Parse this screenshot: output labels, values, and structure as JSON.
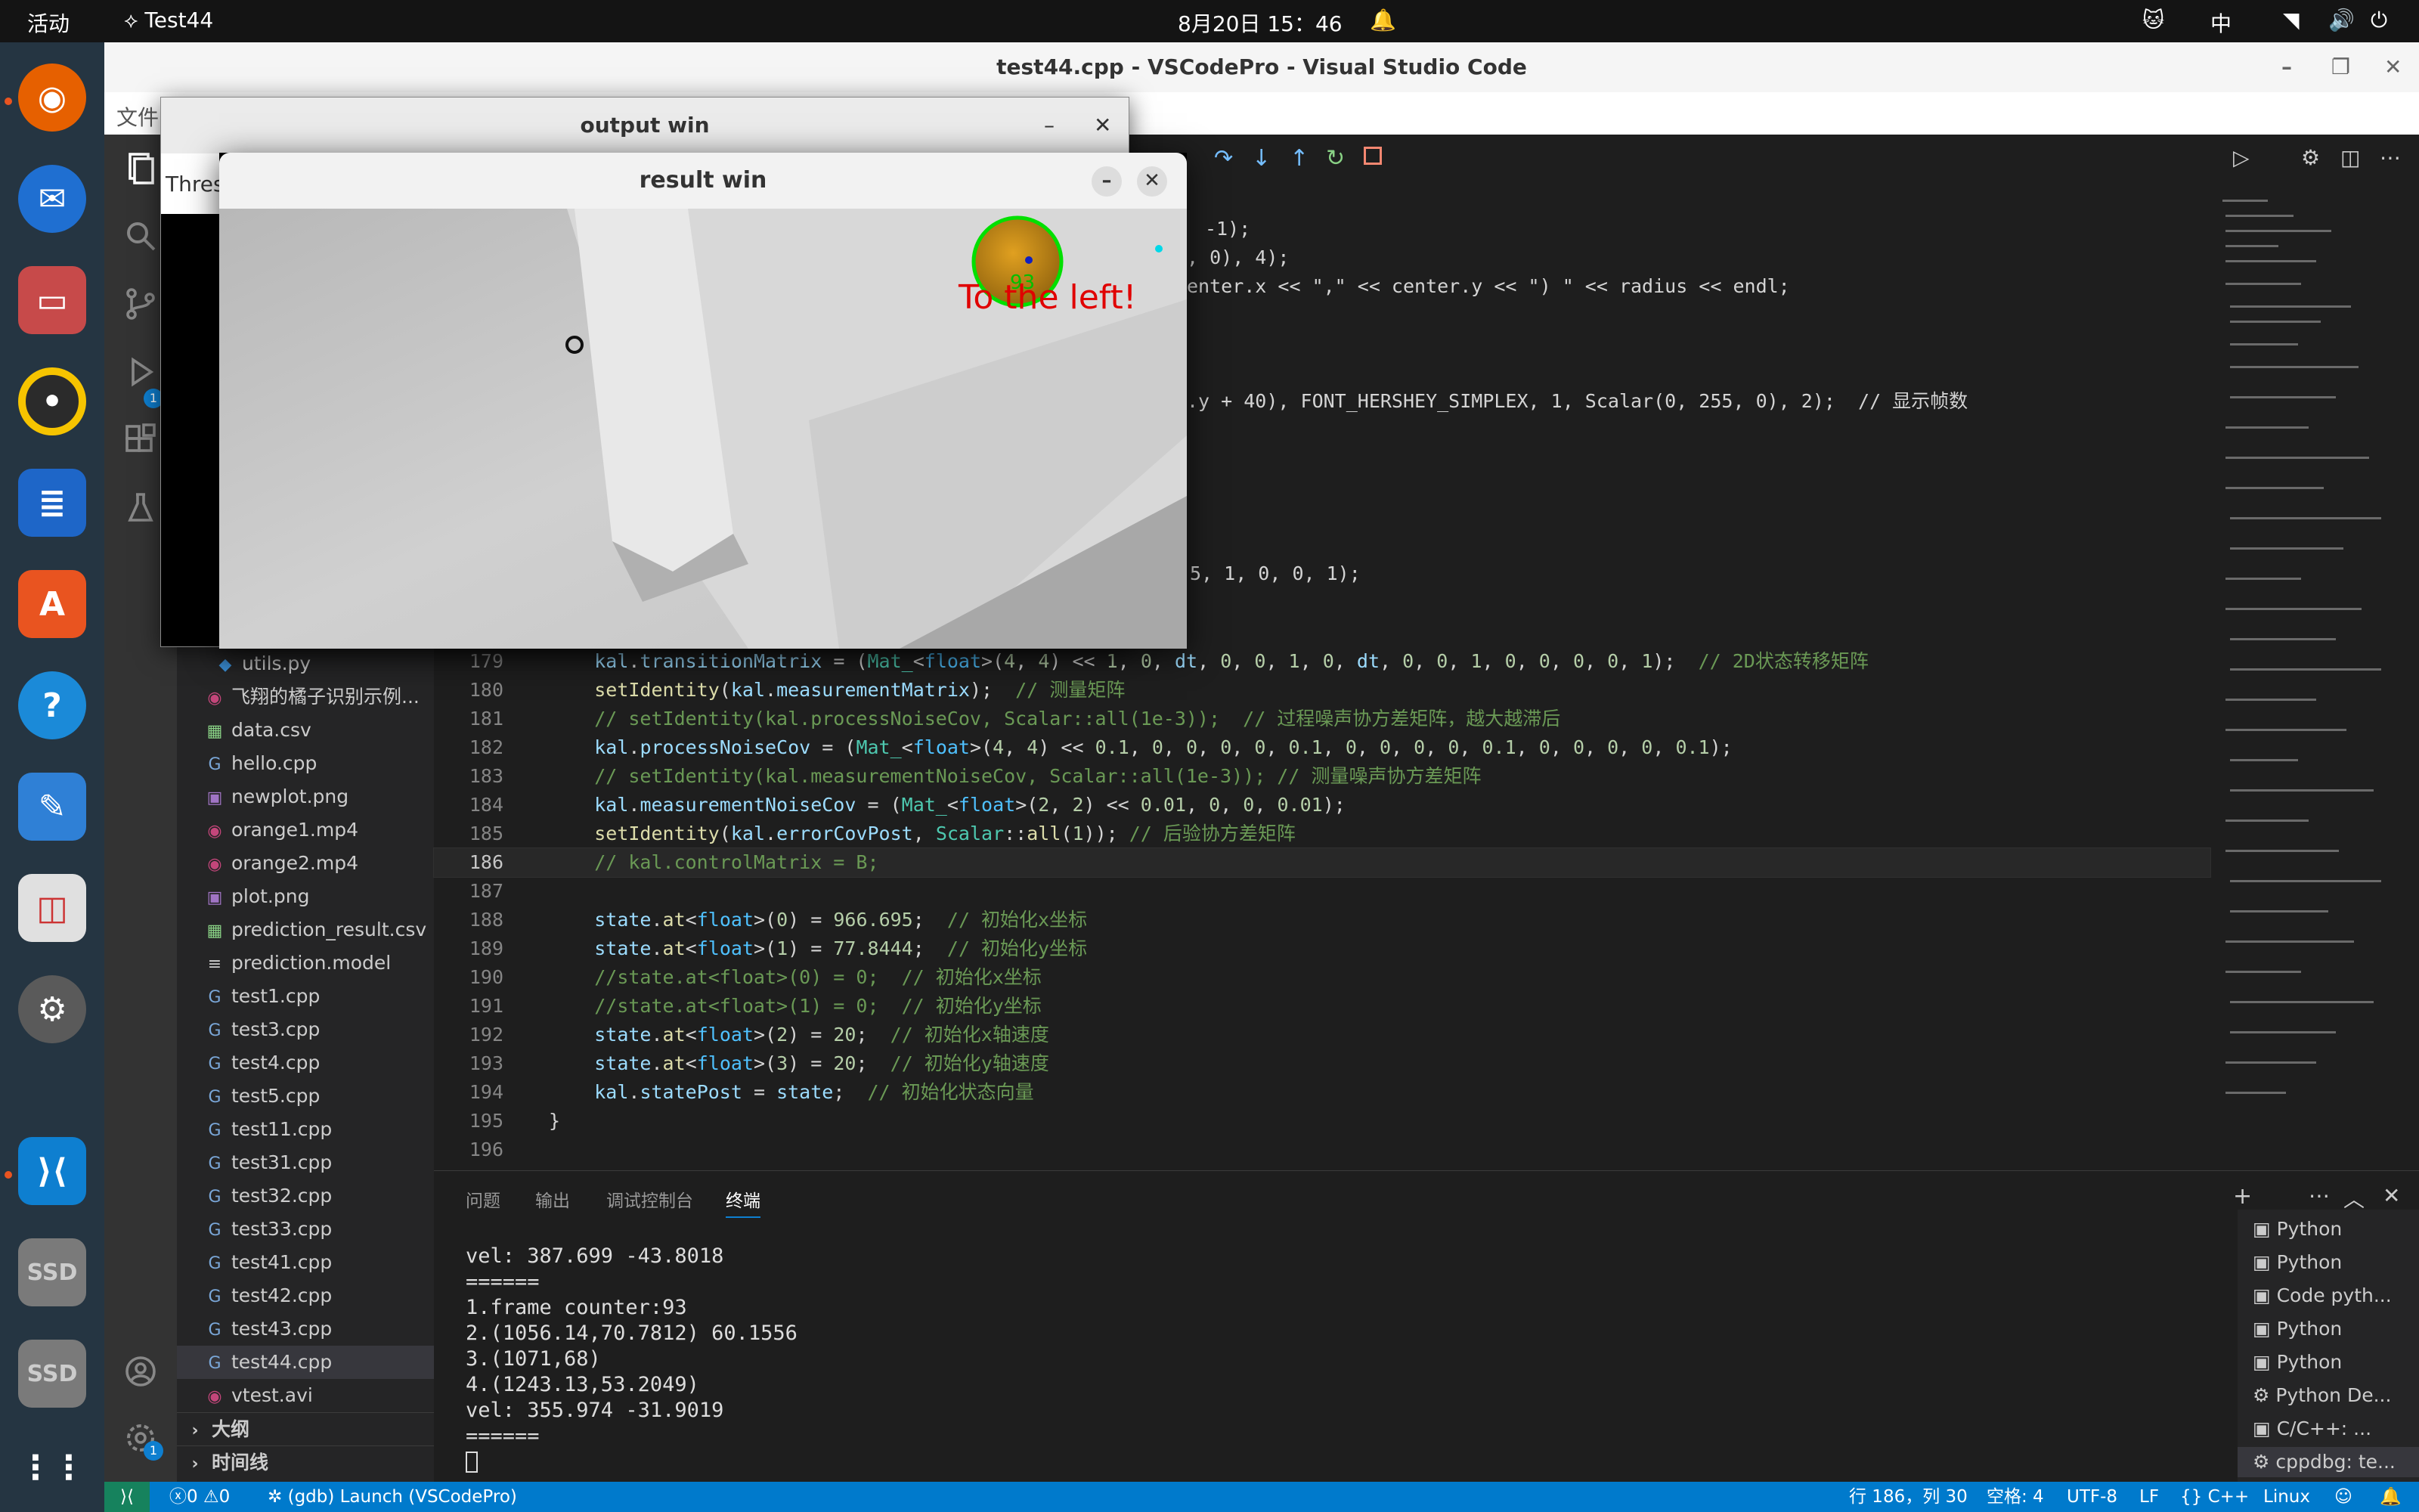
{
  "topbar": {
    "activities": "活动",
    "app": "Test44",
    "clock": "8月20日 15：46",
    "input_method": "中"
  },
  "vscode": {
    "title": "test44.cpp - VSCodePro - Visual Studio Code",
    "menu_first": "文件",
    "explorer_items": [
      "utils.py",
      "飞翔的橘子识别示例...",
      "data.csv",
      "hello.cpp",
      "newplot.png",
      "orange1.mp4",
      "orange2.mp4",
      "plot.png",
      "prediction_result.csv",
      "prediction.model",
      "test1.cpp",
      "test3.cpp",
      "test4.cpp",
      "test5.cpp",
      "test11.cpp",
      "test31.cpp",
      "test32.cpp",
      "test33.cpp",
      "test41.cpp",
      "test42.cpp",
      "test43.cpp",
      "test44.cpp",
      "vtest.avi"
    ],
    "outline": "大纲",
    "timeline": "时间线",
    "code_fragments": {
      "f1": "-1);",
      "f2": ", 0), 4);",
      "f3": "enter.x << \",\" << center.y << \") \" << radius << endl;",
      "f4": ".y + 40), FONT_HERSHEY_SIMPLEX, 1, Scalar(0, 255, 0), 2);  // 显示帧数",
      "f5": "5, 1, 0, 0, 1);"
    },
    "code_lines": [
      {
        "n": "179",
        "t": "    kal.transitionMatrix = (Mat_<float>(4, 4) << 1, 0, dt, 0, 0, 1, 0, dt, 0, 0, 1, 0, 0, 0, 0, 1);  // 2D状态转移矩阵"
      },
      {
        "n": "180",
        "t": "    setIdentity(kal.measurementMatrix);  // 测量矩阵"
      },
      {
        "n": "181",
        "t": "    // setIdentity(kal.processNoiseCov, Scalar::all(1e-3));  // 过程噪声协方差矩阵，越大越滞后"
      },
      {
        "n": "182",
        "t": "    kal.processNoiseCov = (Mat_<float>(4, 4) << 0.1, 0, 0, 0, 0, 0.1, 0, 0, 0, 0, 0.1, 0, 0, 0, 0, 0.1);"
      },
      {
        "n": "183",
        "t": "    // setIdentity(kal.measurementNoiseCov, Scalar::all(1e-3)); // 测量噪声协方差矩阵"
      },
      {
        "n": "184",
        "t": "    kal.measurementNoiseCov = (Mat_<float>(2, 2) << 0.01, 0, 0, 0.01);"
      },
      {
        "n": "185",
        "t": "    setIdentity(kal.errorCovPost, Scalar::all(1)); // 后验协方差矩阵"
      },
      {
        "n": "186",
        "t": "    // kal.controlMatrix = B;"
      },
      {
        "n": "187",
        "t": ""
      },
      {
        "n": "188",
        "t": "    state.at<float>(0) = 966.695;  // 初始化x坐标"
      },
      {
        "n": "189",
        "t": "    state.at<float>(1) = 77.8444;  // 初始化y坐标"
      },
      {
        "n": "190",
        "t": "    //state.at<float>(0) = 0;  // 初始化x坐标"
      },
      {
        "n": "191",
        "t": "    //state.at<float>(1) = 0;  // 初始化y坐标"
      },
      {
        "n": "192",
        "t": "    state.at<float>(2) = 20;  // 初始化x轴速度"
      },
      {
        "n": "193",
        "t": "    state.at<float>(3) = 20;  // 初始化y轴速度"
      },
      {
        "n": "194",
        "t": "    kal.statePost = state;  // 初始化状态向量"
      },
      {
        "n": "195",
        "t": "}"
      },
      {
        "n": "196",
        "t": ""
      }
    ],
    "panel_tabs": [
      "问题",
      "输出",
      "调试控制台",
      "终端"
    ],
    "terminal_lines": [
      "vel: 387.699 -43.8018",
      "======",
      "1.frame counter:93",
      "2.(1056.14,70.7812) 60.1556",
      "3.(1071,68)",
      "4.(1243.13,53.2049)",
      "vel: 355.974 -31.9019",
      "======"
    ],
    "terminal_list": [
      "Python",
      "Python",
      "Code  pyth...",
      "Python",
      "Python",
      "Python De...",
      "C/C++: ...",
      "cppdbg: te..."
    ],
    "status": {
      "errors": "0",
      "warnings": "0",
      "debug": "(gdb) Launch (VSCodePro)",
      "position": "行 186，列 30",
      "spaces": "空格: 4",
      "encoding": "UTF-8",
      "eol": "LF",
      "lang": "C++",
      "os": "Linux"
    }
  },
  "output_window": {
    "title": "output win",
    "partial_text": "Thres"
  },
  "result_window": {
    "title": "result win",
    "overlay_text": "To the left!",
    "frame_number": "93"
  }
}
